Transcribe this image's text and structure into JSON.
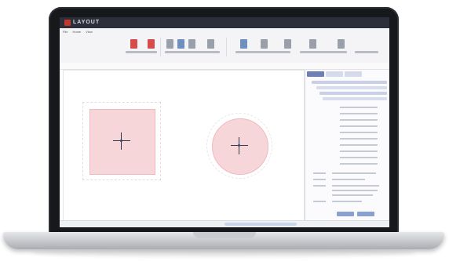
{
  "app": {
    "title": "LAYOUT"
  },
  "ribbon": {
    "tabs": [
      "File",
      "Home",
      "View"
    ],
    "tools": [
      "red",
      "red",
      "gray",
      "blue",
      "gray",
      "gray",
      "blue",
      "gray",
      "gray",
      "gray",
      "gray"
    ]
  },
  "canvas": {
    "shapes": [
      "square",
      "circle"
    ]
  }
}
